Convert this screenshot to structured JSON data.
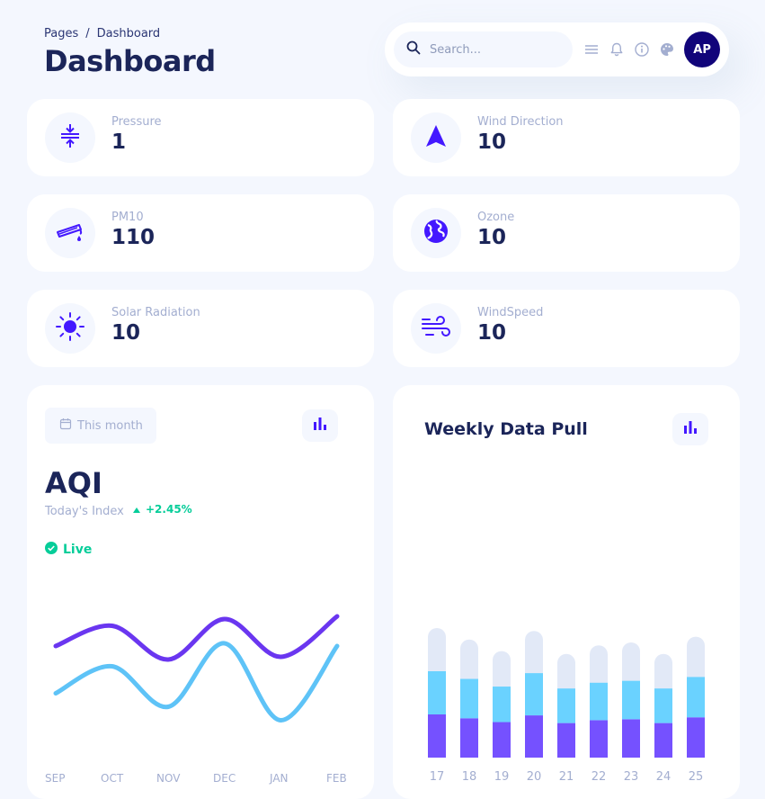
{
  "breadcrumb": {
    "root": "Pages",
    "separator": "/",
    "current": "Dashboard"
  },
  "page_title": "Dashboard",
  "topbar": {
    "search_placeholder": "Search...",
    "icons": [
      "search-icon",
      "menu-icon",
      "bell-icon",
      "info-icon",
      "palette-icon"
    ],
    "avatar_initials": "AP",
    "avatar_color": "#11047a"
  },
  "stats": [
    {
      "label": "Pressure",
      "value": "1",
      "icon": "pressure-icon"
    },
    {
      "label": "Wind Direction",
      "value": "10",
      "icon": "navigation-arrow-icon"
    },
    {
      "label": "PM10",
      "value": "110",
      "icon": "test-tube-icon"
    },
    {
      "label": "Ozone",
      "value": "10",
      "icon": "globe-icon"
    },
    {
      "label": "Solar Radiation",
      "value": "10",
      "icon": "sun-icon"
    },
    {
      "label": "WindSpeed",
      "value": "10",
      "icon": "wind-icon"
    }
  ],
  "aqi_panel": {
    "period_label": "This month",
    "title": "AQI",
    "subtitle": "Today's Index",
    "change": "+2.45%",
    "status": "Live",
    "months": [
      "SEP",
      "OCT",
      "NOV",
      "DEC",
      "JAN",
      "FEB"
    ]
  },
  "weekly_panel": {
    "title": "Weekly Data Pull"
  },
  "colors": {
    "accent": "#4318ff",
    "purple_bar": "#7551ff",
    "cyan_bar": "#6ad2ff",
    "light_bar": "#e2e9f7",
    "green": "#05cd99",
    "navy": "#1b2559",
    "muted": "#a3aed0"
  },
  "chart_data": [
    {
      "type": "line",
      "x": [
        "SEP",
        "OCT",
        "NOV",
        "DEC",
        "JAN",
        "FEB"
      ],
      "series": [
        {
          "values": [
            7,
            8.5,
            6,
            9,
            6.2,
            9.2
          ],
          "color": "#6a36f0"
        },
        {
          "values": [
            3.5,
            5.5,
            2.5,
            7.2,
            1.5,
            7
          ],
          "color": "#5ec3f7"
        }
      ],
      "ylim": [
        0,
        10
      ],
      "grid": false
    },
    {
      "type": "bar",
      "stacked": true,
      "categories": [
        "17",
        "18",
        "19",
        "20",
        "21",
        "22",
        "23",
        "24",
        "25"
      ],
      "series": [
        {
          "values": [
            45,
            41,
            37,
            44,
            36,
            39,
            40,
            36,
            42
          ],
          "color": "#7551ff"
        },
        {
          "values": [
            45,
            41,
            37,
            44,
            36,
            39,
            40,
            36,
            42
          ],
          "color": "#6ad2ff"
        },
        {
          "values": [
            45,
            41,
            37,
            44,
            36,
            39,
            40,
            36,
            42
          ],
          "color": "#e2e9f7"
        }
      ],
      "ylim": [
        0,
        135
      ],
      "grid": false
    }
  ]
}
